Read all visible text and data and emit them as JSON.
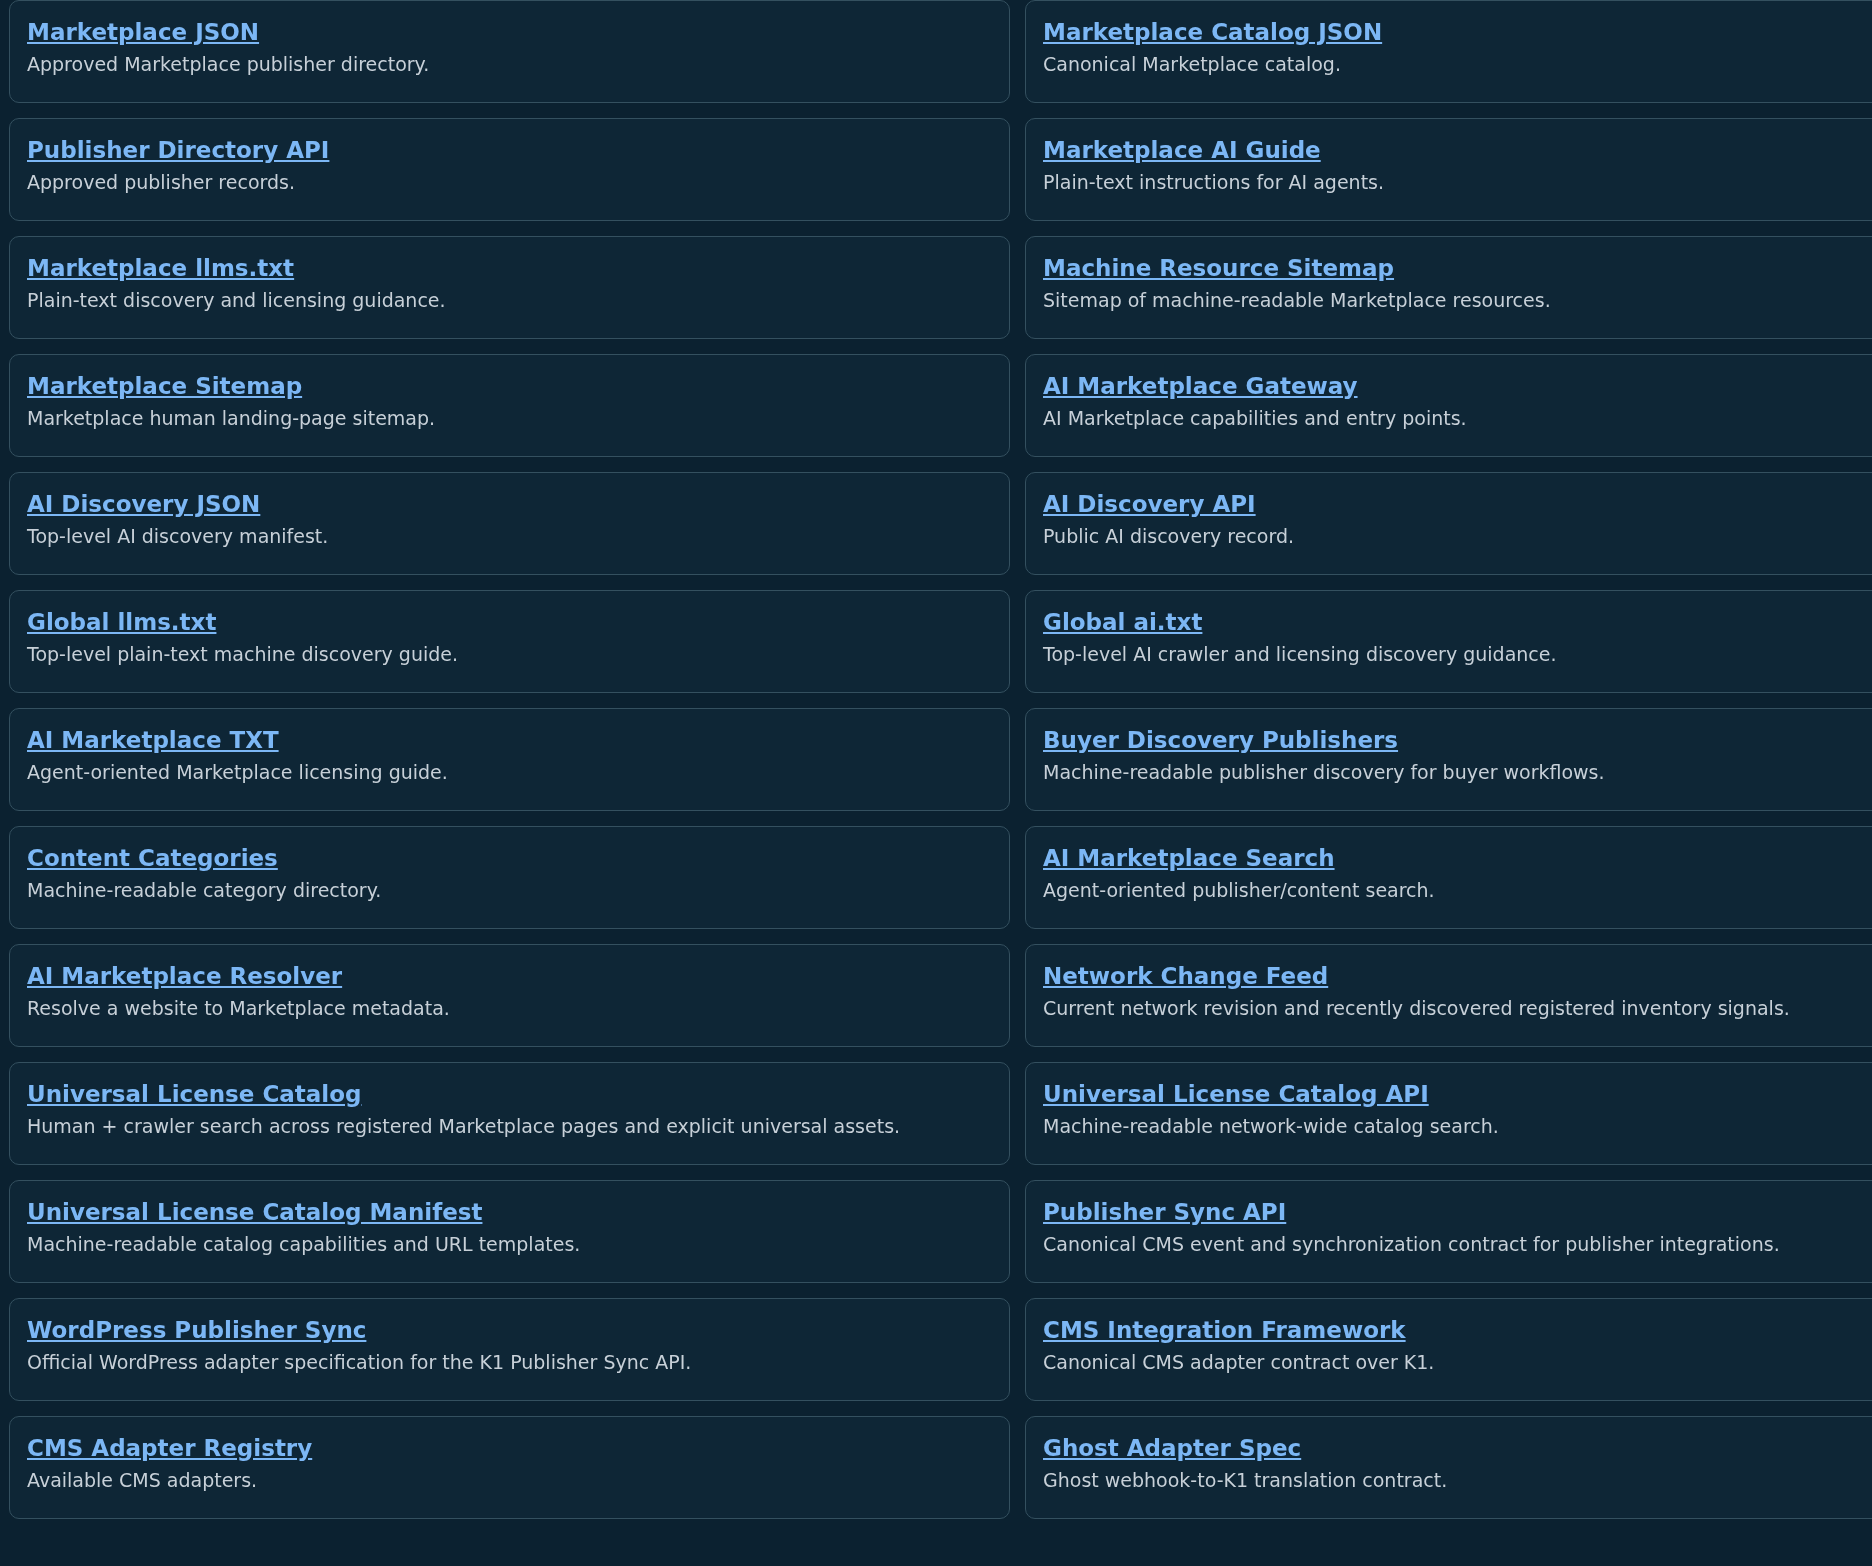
{
  "cards": [
    {
      "title": "Marketplace JSON",
      "description": "Approved Marketplace publisher directory."
    },
    {
      "title": "Marketplace Catalog JSON",
      "description": "Canonical Marketplace catalog."
    },
    {
      "title": "Publisher Directory API",
      "description": "Approved publisher records."
    },
    {
      "title": "Marketplace AI Guide",
      "description": "Plain-text instructions for AI agents."
    },
    {
      "title": "Marketplace llms.txt",
      "description": "Plain-text discovery and licensing guidance."
    },
    {
      "title": "Machine Resource Sitemap",
      "description": "Sitemap of machine-readable Marketplace resources."
    },
    {
      "title": "Marketplace Sitemap",
      "description": "Marketplace human landing-page sitemap."
    },
    {
      "title": "AI Marketplace Gateway",
      "description": "AI Marketplace capabilities and entry points."
    },
    {
      "title": "AI Discovery JSON",
      "description": "Top-level AI discovery manifest."
    },
    {
      "title": "AI Discovery API",
      "description": "Public AI discovery record."
    },
    {
      "title": "Global llms.txt",
      "description": "Top-level plain-text machine discovery guide."
    },
    {
      "title": "Global ai.txt",
      "description": "Top-level AI crawler and licensing discovery guidance."
    },
    {
      "title": "AI Marketplace TXT",
      "description": "Agent-oriented Marketplace licensing guide."
    },
    {
      "title": "Buyer Discovery Publishers",
      "description": "Machine-readable publisher discovery for buyer workflows."
    },
    {
      "title": "Content Categories",
      "description": "Machine-readable category directory."
    },
    {
      "title": "AI Marketplace Search",
      "description": "Agent-oriented publisher/content search."
    },
    {
      "title": "AI Marketplace Resolver",
      "description": "Resolve a website to Marketplace metadata."
    },
    {
      "title": "Network Change Feed",
      "description": "Current network revision and recently discovered registered inventory signals."
    },
    {
      "title": "Universal License Catalog",
      "description": "Human + crawler search across registered Marketplace pages and explicit universal assets."
    },
    {
      "title": "Universal License Catalog API",
      "description": "Machine-readable network-wide catalog search."
    },
    {
      "title": "Universal License Catalog Manifest",
      "description": "Machine-readable catalog capabilities and URL templates."
    },
    {
      "title": "Publisher Sync API",
      "description": "Canonical CMS event and synchronization contract for publisher integrations."
    },
    {
      "title": "WordPress Publisher Sync",
      "description": "Official WordPress adapter specification for the K1 Publisher Sync API."
    },
    {
      "title": "CMS Integration Framework",
      "description": "Canonical CMS adapter contract over K1."
    },
    {
      "title": "CMS Adapter Registry",
      "description": "Available CMS adapters."
    },
    {
      "title": "Ghost Adapter Spec",
      "description": "Ghost webhook-to-K1 translation contract."
    }
  ]
}
